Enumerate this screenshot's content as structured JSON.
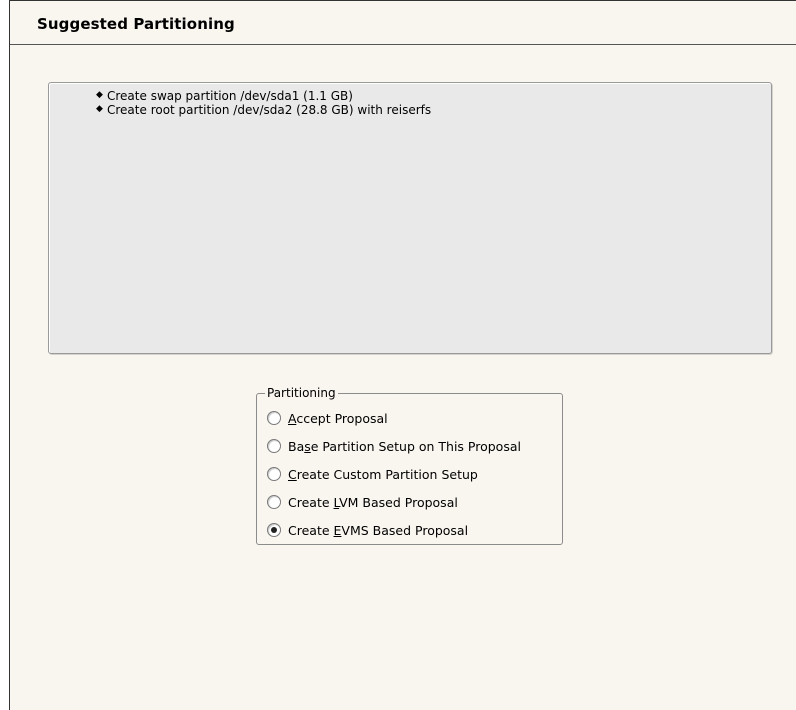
{
  "page": {
    "title": "Suggested Partitioning"
  },
  "summary": {
    "items": [
      "Create swap partition /dev/sda1 (1.1 GB)",
      "Create root partition /dev/sda2 (28.8 GB) with reiserfs"
    ]
  },
  "partitioning": {
    "label": "Partitioning",
    "options": [
      {
        "pre": "",
        "mnemonic": "A",
        "post": "ccept Proposal",
        "checked": false
      },
      {
        "pre": "Ba",
        "mnemonic": "s",
        "post": "e Partition Setup on This Proposal",
        "checked": false
      },
      {
        "pre": "",
        "mnemonic": "C",
        "post": "reate Custom Partition Setup",
        "checked": false
      },
      {
        "pre": "Create ",
        "mnemonic": "L",
        "post": "VM Based Proposal",
        "checked": false
      },
      {
        "pre": "Create ",
        "mnemonic": "E",
        "post": "VMS Based Proposal",
        "checked": true
      }
    ]
  }
}
